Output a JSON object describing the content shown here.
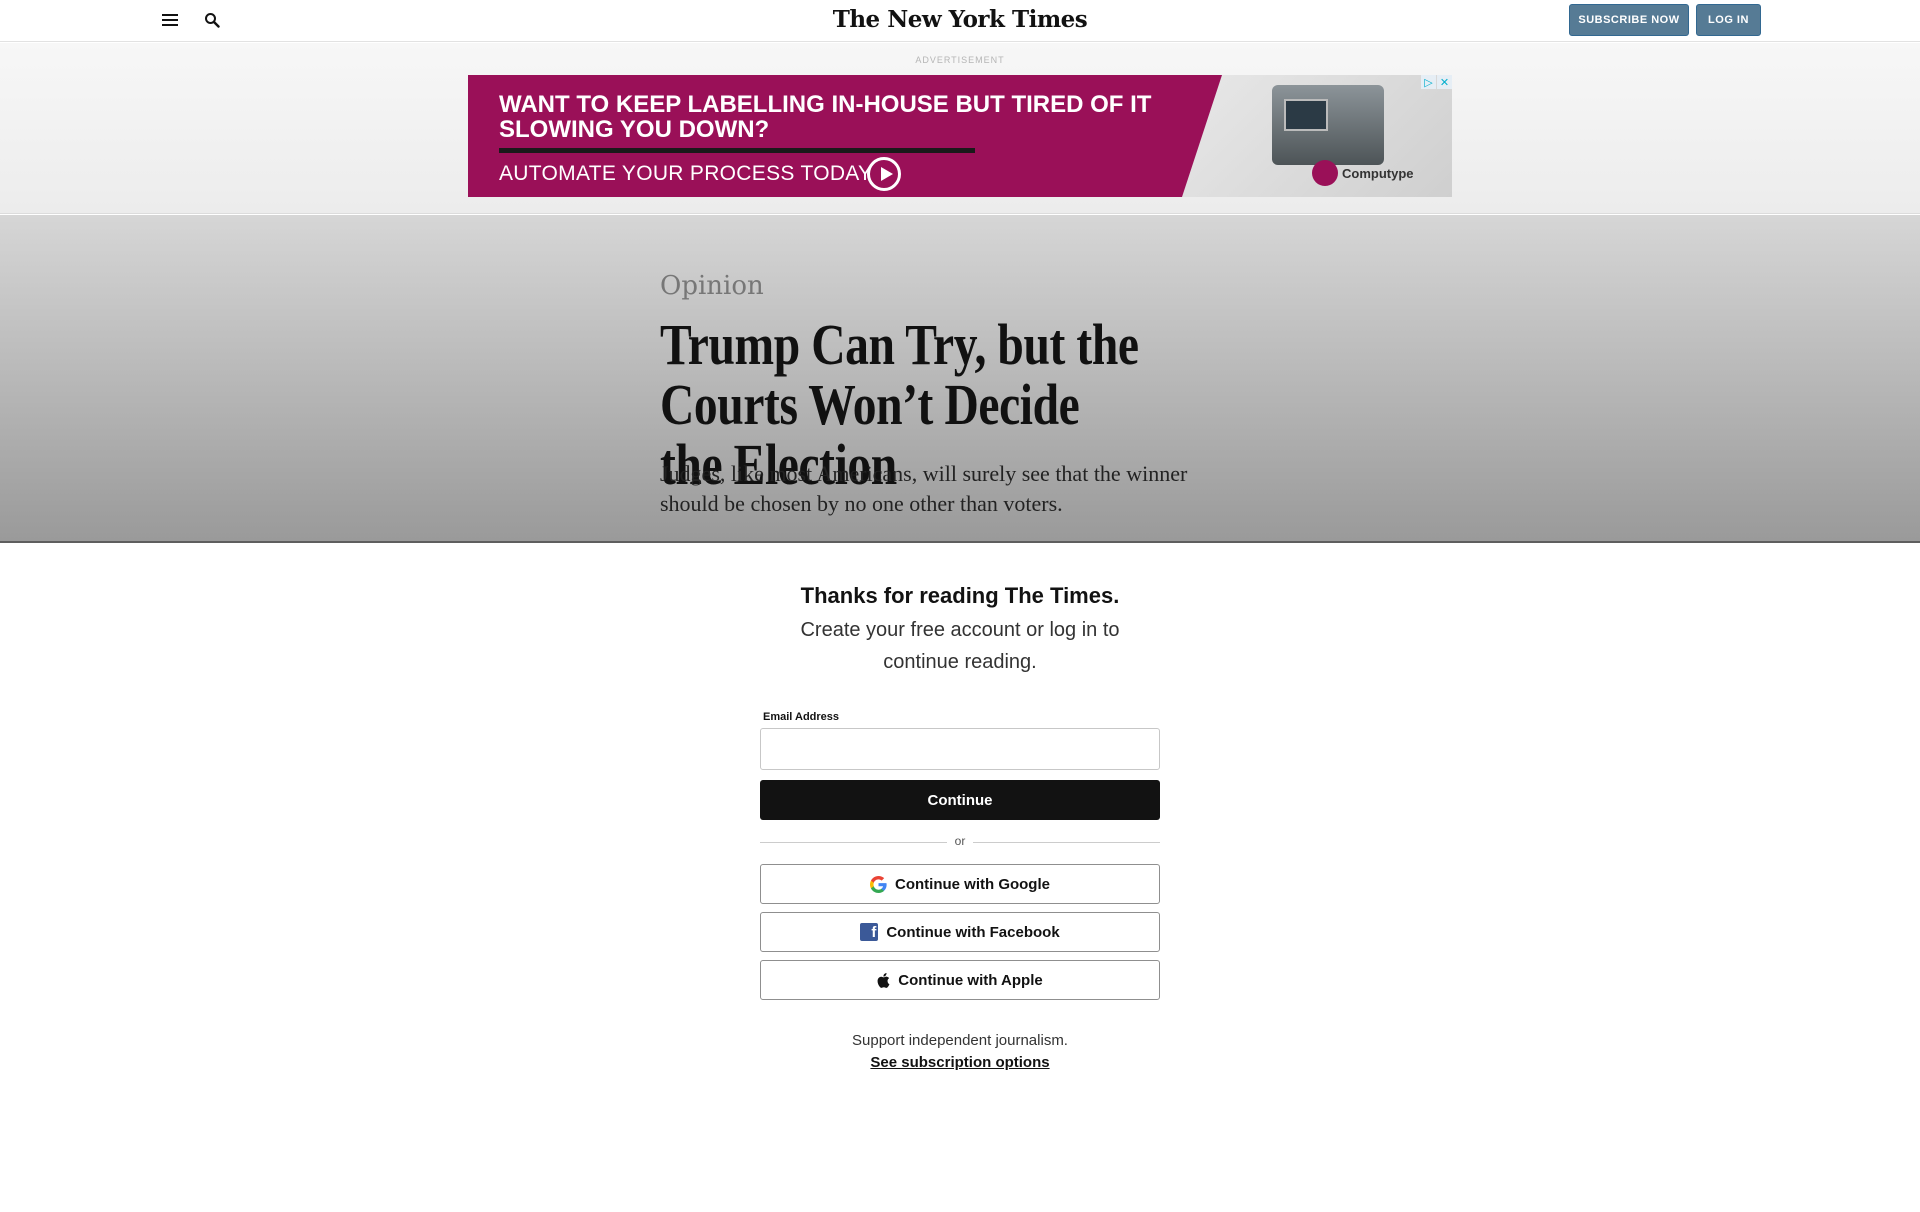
{
  "header": {
    "logo": "The New York Times",
    "subscribe_label": "SUBSCRIBE NOW",
    "login_label": "LOG IN",
    "menu_icon": "hamburger-menu-icon",
    "search_icon": "magnifier-icon"
  },
  "ad": {
    "label": "ADVERTISEMENT",
    "headline": "WANT TO KEEP LABELLING IN-HOUSE BUT TIRED OF IT SLOWING YOU DOWN?",
    "cta": "AUTOMATE YOUR PROCESS TODAY",
    "brand": "Computype",
    "adchoices_icon": "▷",
    "close_icon": "✕",
    "background_color": "#9a1058"
  },
  "article": {
    "kicker": "Opinion",
    "headline": "Trump Can Try, but the Courts Won’t Decide the Election",
    "summary": "Judges, like most Americans, will surely see that the winner should be chosen by no one other than voters."
  },
  "regwall": {
    "title": "Thanks for reading The Times.",
    "subtitle": "Create your free account or log in to continue reading.",
    "email_label": "Email Address",
    "email_value": "",
    "continue_label": "Continue",
    "or_label": "or",
    "google_label": "Continue with Google",
    "facebook_label": "Continue with Facebook",
    "apple_label": "Continue with Apple",
    "support_text": "Support independent journalism.",
    "subscription_link": "See subscription options"
  }
}
